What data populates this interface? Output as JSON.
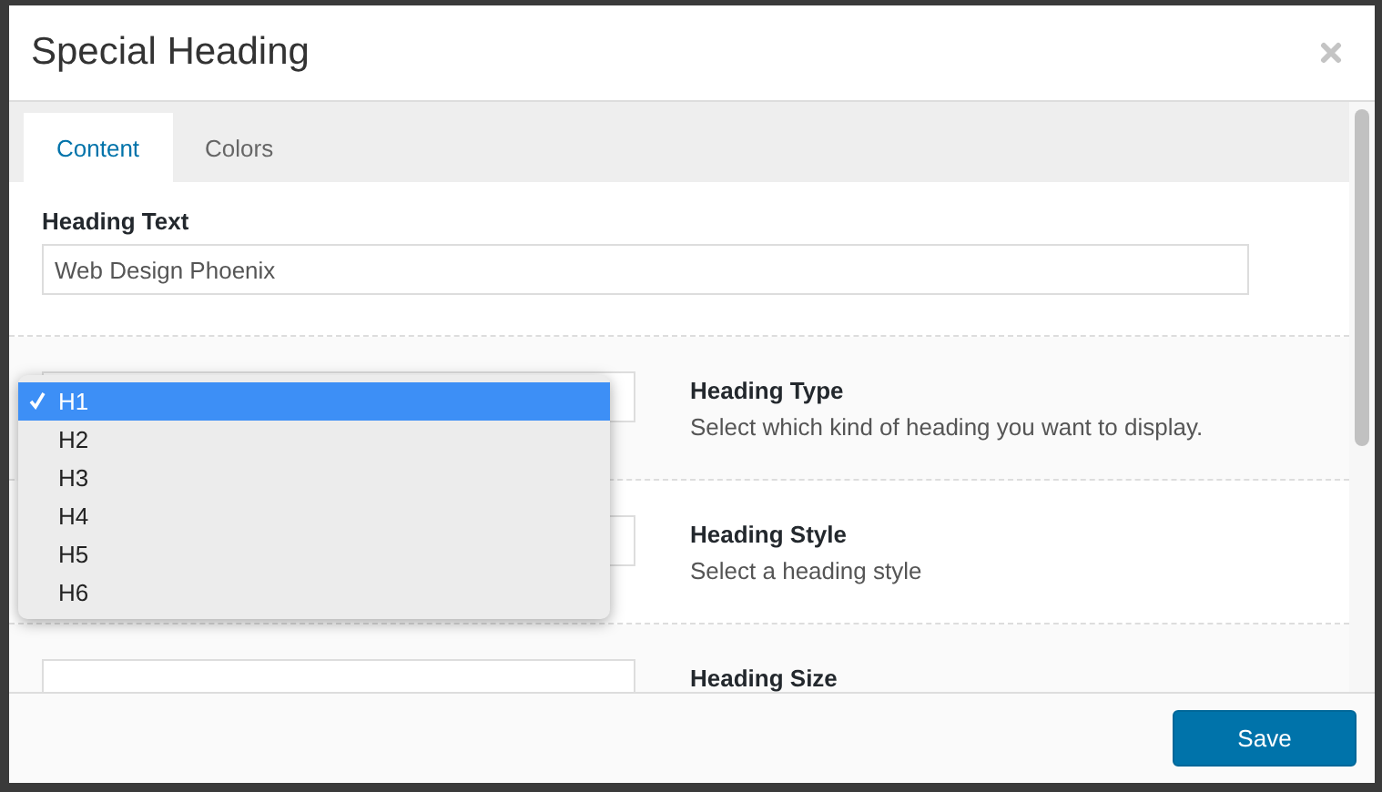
{
  "dialog": {
    "title": "Special Heading"
  },
  "tabs": [
    {
      "label": "Content",
      "selected": true
    },
    {
      "label": "Colors",
      "selected": false
    }
  ],
  "heading_text": {
    "label": "Heading Text",
    "value": "Web Design Phoenix"
  },
  "settings": [
    {
      "title": "Heading Type",
      "description": "Select which kind of heading you want to display.",
      "options": [
        {
          "label": "H1",
          "selected": true
        },
        {
          "label": "H2",
          "selected": false
        },
        {
          "label": "H3",
          "selected": false
        },
        {
          "label": "H4",
          "selected": false
        },
        {
          "label": "H5",
          "selected": false
        },
        {
          "label": "H6",
          "selected": false
        }
      ]
    },
    {
      "title": "Heading Style",
      "description": "Select a heading style"
    },
    {
      "title": "Heading Size"
    }
  ],
  "save_button": "Save"
}
